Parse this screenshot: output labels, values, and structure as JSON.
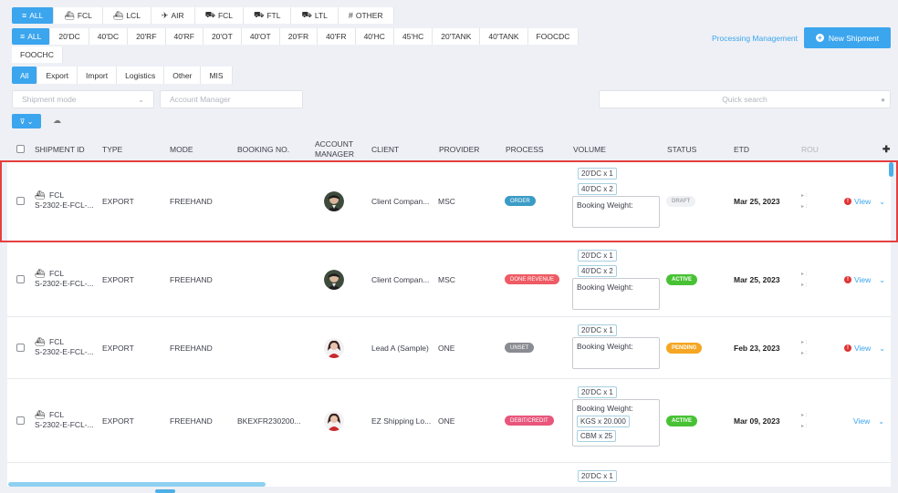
{
  "mode_tabs": [
    {
      "icon": "≡",
      "label": "ALL",
      "active": true
    },
    {
      "icon": "⛴",
      "label": "FCL",
      "active": false
    },
    {
      "icon": "⛴",
      "label": "LCL",
      "active": false
    },
    {
      "icon": "✈",
      "label": "AIR",
      "active": false
    },
    {
      "icon": "⛟",
      "label": "FCL",
      "active": false
    },
    {
      "icon": "⛟",
      "label": "FTL",
      "active": false
    },
    {
      "icon": "⛟",
      "label": "LTL",
      "active": false
    },
    {
      "icon": "#",
      "label": "OTHER",
      "active": false
    }
  ],
  "container_tabs": [
    {
      "icon": "≡",
      "label": "ALL",
      "active": true
    },
    {
      "label": "20'DC"
    },
    {
      "label": "40'DC"
    },
    {
      "label": "20'RF"
    },
    {
      "label": "40'RF"
    },
    {
      "label": "20'OT"
    },
    {
      "label": "40'OT"
    },
    {
      "label": "20'FR"
    },
    {
      "label": "40'FR"
    },
    {
      "label": "40'HC"
    },
    {
      "label": "45'HC"
    },
    {
      "label": "20'TANK"
    },
    {
      "label": "40'TANK"
    },
    {
      "label": "FOOCDC"
    },
    {
      "label": "FOOCHC"
    }
  ],
  "type_tabs": [
    {
      "label": "All",
      "active": true
    },
    {
      "label": "Export"
    },
    {
      "label": "Import"
    },
    {
      "label": "Logistics"
    },
    {
      "label": "Other"
    },
    {
      "label": "MIS"
    }
  ],
  "processing_link": "Processing Management",
  "new_shipment_label": "New Shipment",
  "filters": {
    "shipment_mode_placeholder": "Shipment mode",
    "account_manager_placeholder": "Account Manager",
    "quick_search_placeholder": "Quick search"
  },
  "columns": [
    "SHIPMENT ID",
    "TYPE",
    "MODE",
    "BOOKING NO.",
    "ACCOUNT MANAGER",
    "CLIENT",
    "PROVIDER",
    "PROCESS",
    "VOLUME",
    "STATUS",
    "ETD",
    "ROU"
  ],
  "rows": [
    {
      "mode": "FCL",
      "id": "S-2302-E-FCL-...",
      "type": "EXPORT",
      "shipment_mode": "FREEHAND",
      "booking": "",
      "client": "Client Compan...",
      "provider": "MSC",
      "process": "ORDER",
      "process_color": "#3a9cc6",
      "chips": [
        "20'DC x 1",
        "40'DC x 2"
      ],
      "weight_label": "Booking Weight:",
      "weight_chips": [],
      "status": "DRAFT",
      "status_color": "#f0f1f4",
      "status_text": "#a4a7ad",
      "etd": "Mar 25, 2023",
      "view": "View",
      "warn": true,
      "avatar": "man"
    },
    {
      "mode": "FCL",
      "id": "S-2302-E-FCL-...",
      "type": "EXPORT",
      "shipment_mode": "FREEHAND",
      "booking": "",
      "client": "Client Compan...",
      "provider": "MSC",
      "process": "DONE REVENUE",
      "process_color": "#ef5b64",
      "chips": [
        "20'DC x 1",
        "40'DC x 2"
      ],
      "weight_label": "Booking Weight:",
      "weight_chips": [],
      "status": "ACTIVE",
      "status_color": "#48c234",
      "status_text": "#ffffff",
      "etd": "Mar 25, 2023",
      "view": "View",
      "warn": true,
      "avatar": "man"
    },
    {
      "mode": "FCL",
      "id": "S-2302-E-FCL-...",
      "type": "EXPORT",
      "shipment_mode": "FREEHAND",
      "booking": "",
      "client": "Lead A (Sample)",
      "provider": "ONE",
      "process": "UNSET",
      "process_color": "#8a8c92",
      "chips": [
        "20'DC x 1"
      ],
      "weight_label": "Booking Weight:",
      "weight_chips": [],
      "status": "PENDING",
      "status_color": "#f5a623",
      "status_text": "#ffffff",
      "etd": "Feb 23, 2023",
      "view": "View",
      "warn": true,
      "avatar": "woman"
    },
    {
      "mode": "FCL",
      "id": "S-2302-E-FCL-...",
      "type": "EXPORT",
      "shipment_mode": "FREEHAND",
      "booking": "BKEXFR230200...",
      "client": "EZ Shipping Lo...",
      "provider": "ONE",
      "process": "DEBIT/CREDIT",
      "process_color": "#e8567c",
      "chips": [
        "20'DC x 1"
      ],
      "weight_label": "Booking Weight:",
      "weight_chips": [
        "KGS x 20.000",
        "CBM x 25"
      ],
      "status": "ACTIVE",
      "status_color": "#48c234",
      "status_text": "#ffffff",
      "etd": "Mar 09, 2023",
      "view": "View",
      "warn": false,
      "avatar": "woman"
    }
  ],
  "partial_row_chip": "20'DC x 1"
}
